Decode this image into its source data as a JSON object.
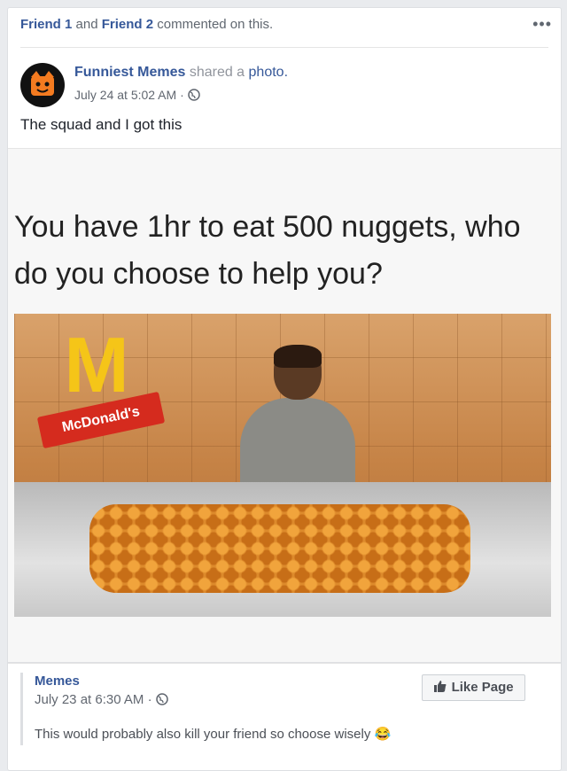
{
  "notice": {
    "friend1": "Friend 1",
    "and_text": "and",
    "friend2": "Friend 2",
    "action": "commented on this."
  },
  "more_label": "•••",
  "post": {
    "page_name": "Funniest Memes",
    "shared_text": "shared a",
    "photo_text": "photo.",
    "time": "July 24 at 5:02 AM ·",
    "text": "The squad and I got this"
  },
  "meme": {
    "line1": "You have 1hr to eat 500 nuggets, who",
    "line2": "do you choose to help you?"
  },
  "photo_sign": "McDonald's",
  "comment": {
    "author": "Memes",
    "time": "July 23 at 6:30 AM ·",
    "text": "This would probably also kill your friend so choose wisely 😂"
  },
  "like_button": "Like Page",
  "colors": {
    "link": "#365899",
    "meta": "#616770",
    "avatar_bg": "#111111",
    "avatar_fg": "#f47b20"
  },
  "icons": {
    "globe": "globe-icon",
    "thumb": "thumbs-up-icon",
    "avatar": "cat-face-icon"
  }
}
